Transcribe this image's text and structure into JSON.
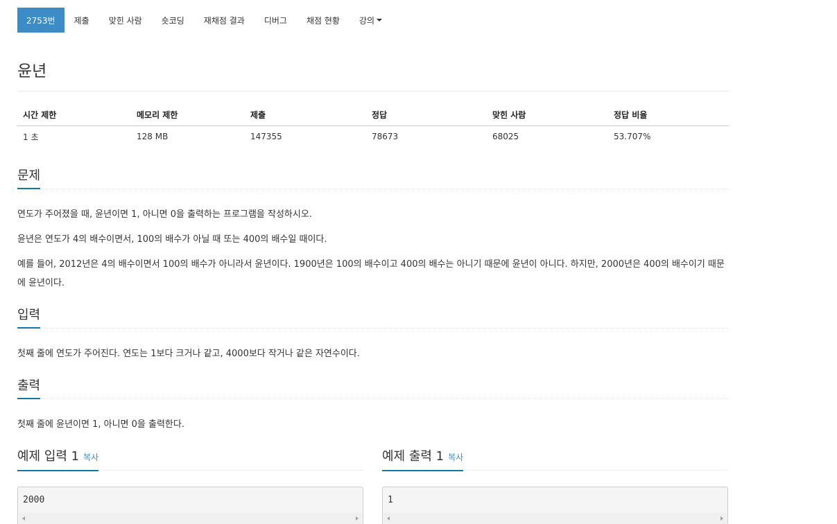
{
  "nav": {
    "tabs": [
      {
        "label": "2753번",
        "active": true
      },
      {
        "label": "제출"
      },
      {
        "label": "맞힌 사람"
      },
      {
        "label": "숏코딩"
      },
      {
        "label": "재채점 결과"
      },
      {
        "label": "디버그"
      },
      {
        "label": "채점 현황"
      },
      {
        "label": "강의"
      }
    ]
  },
  "title": "윤년",
  "info": {
    "headers": [
      "시간 제한",
      "메모리 제한",
      "제출",
      "정답",
      "맞힌 사람",
      "정답 비율"
    ],
    "values": [
      "1 초",
      "128 MB",
      "147355",
      "78673",
      "68025",
      "53.707%"
    ]
  },
  "problem": {
    "heading": "문제",
    "paragraphs": [
      "연도가 주어졌을 때, 윤년이면 1, 아니면 0을 출력하는 프로그램을 작성하시오.",
      "윤년은 연도가 4의 배수이면서, 100의 배수가 아닐 때 또는 400의 배수일 때이다.",
      "예를 들어, 2012년은 4의 배수이면서 100의 배수가 아니라서 윤년이다. 1900년은 100의 배수이고 400의 배수는 아니기 때문에 윤년이 아니다. 하지만, 2000년은 400의 배수이기 때문에 윤년이다."
    ]
  },
  "input": {
    "heading": "입력",
    "text": "첫째 줄에 연도가 주어진다. 연도는 1보다 크거나 같고, 4000보다 작거나 같은 자연수이다."
  },
  "output": {
    "heading": "출력",
    "text": "첫째 줄에 윤년이면 1, 아니면 0을 출력한다."
  },
  "samples": {
    "input": {
      "heading": "예제 입력 1",
      "copy": "복사",
      "value": "2000"
    },
    "output": {
      "heading": "예제 출력 1",
      "copy": "복사",
      "value": "1"
    }
  },
  "colors": {
    "accent": "#3c8dc7",
    "underline": "#0e76a8"
  }
}
